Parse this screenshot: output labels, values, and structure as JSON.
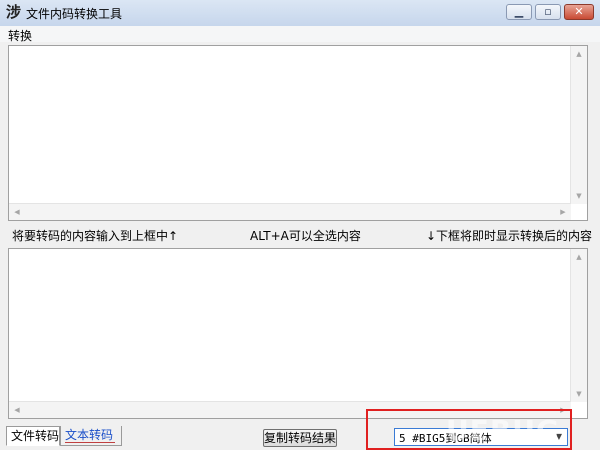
{
  "window": {
    "title": "文件内码转换工具"
  },
  "menu": {
    "items": [
      {
        "label": "转换"
      }
    ]
  },
  "hints": {
    "left": "将要转码的内容输入到上框中↑",
    "middle": "ALT+A可以全选内容",
    "right": "↓下框将即时显示转换后的内容"
  },
  "tabs": [
    {
      "label": "文件转码"
    },
    {
      "label": "文本转码"
    }
  ],
  "buttons": {
    "copy_result": "复制转码结果"
  },
  "conversion_select": {
    "selected": "5 #BIG5到GB简体"
  },
  "watermark": {
    "text": "UEBUG"
  },
  "icons": {
    "app": "app-icon",
    "minimize": "minimize-icon",
    "maximize": "maximize-icon",
    "close": "close-icon"
  },
  "colors": {
    "highlight_box": "#e02020",
    "tab_active_text": "#1a4fc9"
  }
}
